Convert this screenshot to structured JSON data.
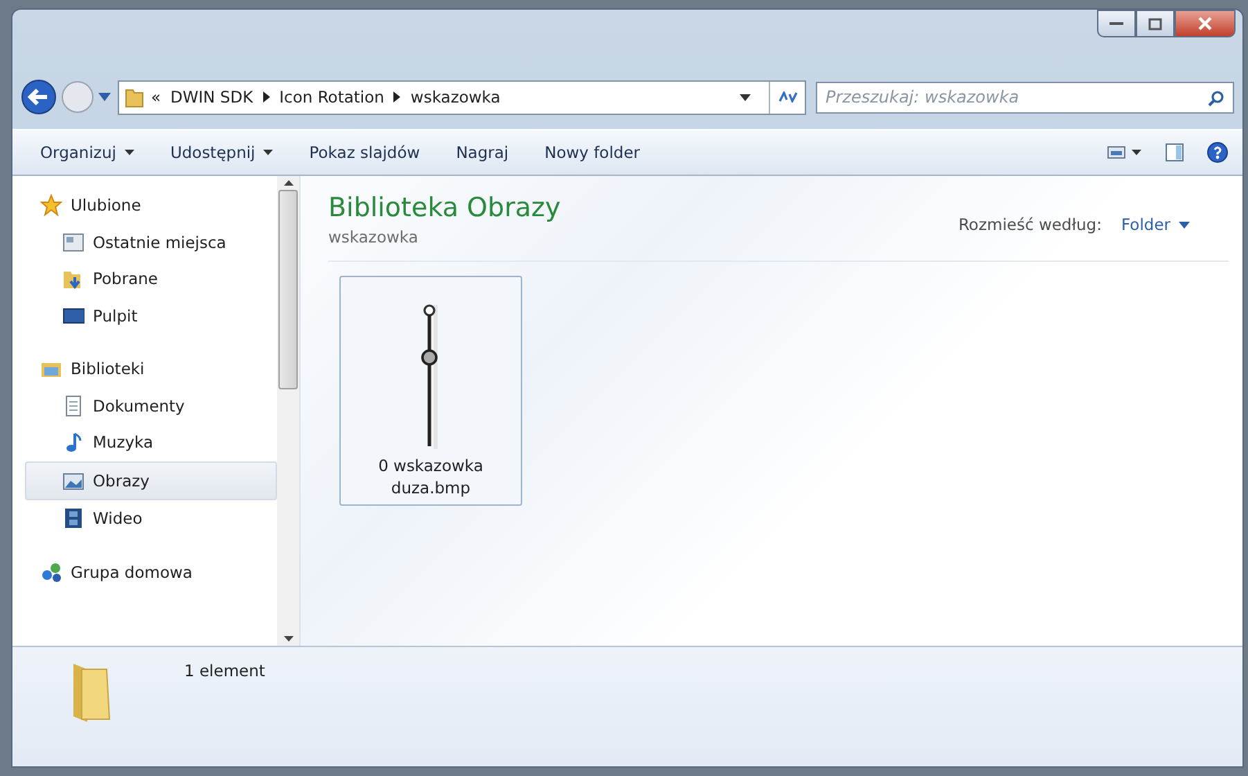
{
  "address_bar": {
    "breadcrumb": [
      "«",
      "DWIN SDK",
      "Icon Rotation",
      "wskazowka"
    ]
  },
  "search": {
    "placeholder": "Przeszukaj: wskazowka"
  },
  "toolbar": {
    "items": [
      {
        "label": "Organizuj",
        "dropdown": true
      },
      {
        "label": "Udostępnij",
        "dropdown": true
      },
      {
        "label": "Pokaz slajdów",
        "dropdown": false
      },
      {
        "label": "Nagraj",
        "dropdown": false
      },
      {
        "label": "Nowy folder",
        "dropdown": false
      }
    ]
  },
  "sidebar": {
    "groups": [
      {
        "label": "Ulubione",
        "selected": false,
        "children": [
          {
            "label": "Ostatnie miejsca",
            "selected": false
          },
          {
            "label": "Pobrane",
            "selected": false
          },
          {
            "label": "Pulpit",
            "selected": false
          }
        ]
      },
      {
        "label": "Biblioteki",
        "selected": false,
        "children": [
          {
            "label": "Dokumenty",
            "selected": false
          },
          {
            "label": "Muzyka",
            "selected": false
          },
          {
            "label": "Obrazy",
            "selected": true
          },
          {
            "label": "Wideo",
            "selected": false
          }
        ]
      },
      {
        "label": "Grupa domowa",
        "selected": false
      }
    ]
  },
  "content": {
    "title": "Biblioteka Obrazy",
    "subtitle": "wskazowka",
    "arrange_label": "Rozmieść według:",
    "arrange_value": "Folder",
    "files": [
      {
        "name": "0 wskazowka duza.bmp",
        "selected": true
      }
    ]
  },
  "status_bar": {
    "count": "1 element"
  }
}
